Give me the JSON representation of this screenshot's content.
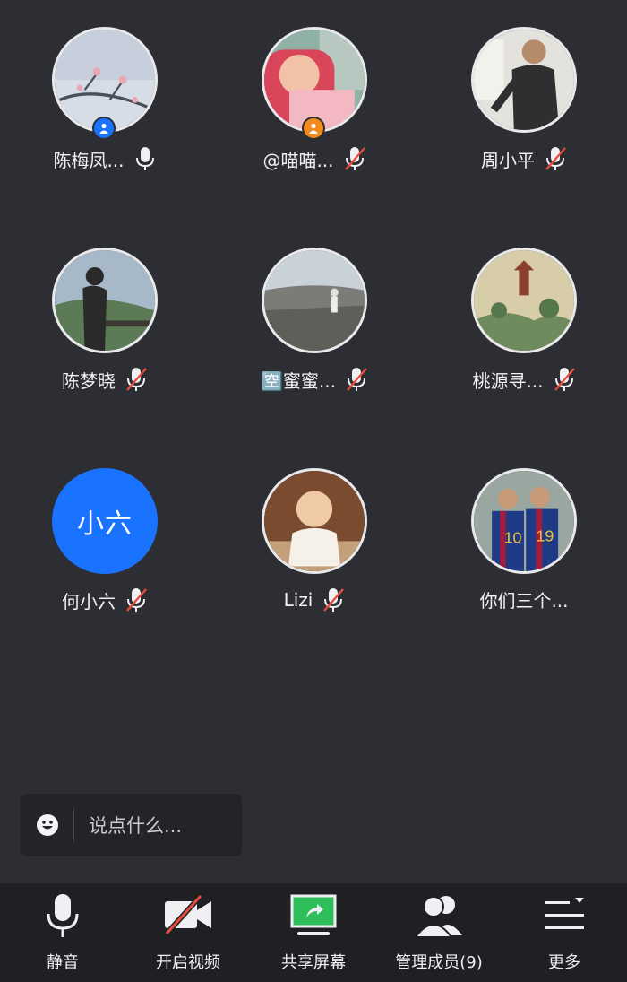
{
  "participants": [
    {
      "name": "陈梅凤...",
      "muted": false,
      "badge": "host"
    },
    {
      "name": "@喵喵...",
      "muted": true,
      "badge": "cohost"
    },
    {
      "name": "周小平",
      "muted": true
    },
    {
      "name": "陈梦晓",
      "muted": true
    },
    {
      "name": "🈳蜜蜜...",
      "muted": true
    },
    {
      "name": "桃源寻...",
      "muted": true
    },
    {
      "name": "何小六",
      "muted": true,
      "avatar_text": "小六"
    },
    {
      "name": "Lizi",
      "muted": true
    },
    {
      "name": "你们三个...",
      "muted": null
    }
  ],
  "chat": {
    "placeholder": "说点什么..."
  },
  "toolbar": {
    "mute_label": "静音",
    "video_label": "开启视频",
    "share_label": "共享屏幕",
    "members_label": "管理成员(9)",
    "more_label": "更多"
  },
  "colors": {
    "background": "#2c2e33",
    "toolbar_bg": "#1f2023",
    "accent_blue": "#1a73ff",
    "badge_orange": "#f28a1e",
    "mute_red": "#e74c3c",
    "share_green": "#2fbf5a"
  }
}
